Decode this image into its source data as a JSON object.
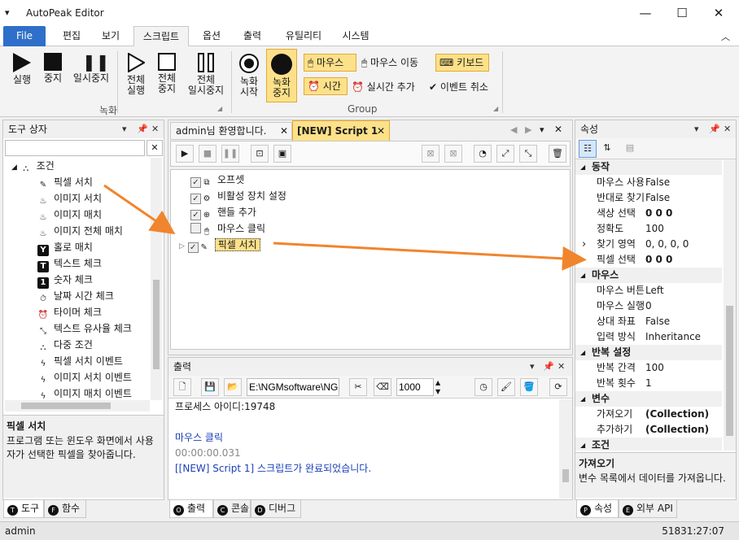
{
  "app": {
    "title": "AutoPeak Editor"
  },
  "menu_tabs": [
    "File",
    "편집",
    "보기",
    "스크립트",
    "옵션",
    "출력",
    "유틸리티",
    "시스템"
  ],
  "ribbon": {
    "record_group": "녹화",
    "group2": "Group",
    "buttons": {
      "run": "실행",
      "stop": "중지",
      "pause": "일시중지",
      "run_all_1": "전체",
      "run_all_2": "실행",
      "stop_all_1": "전체",
      "stop_all_2": "중지",
      "pause_all_1": "전체",
      "pause_all_2": "일시중지",
      "rec_start_1": "녹화",
      "rec_start_2": "시작",
      "rec_stop_1": "녹화",
      "rec_stop_2": "중지"
    },
    "opts": {
      "mouse": "마우스",
      "mouse_move": "마우스 이동",
      "keyboard": "키보드",
      "time": "시간",
      "realtime_add": "실시간 추가",
      "event_cancel": "이벤트 취소"
    }
  },
  "toolbox": {
    "title": "도구 상자",
    "root": "조건",
    "items": [
      "픽셀 서치",
      "이미지 서치",
      "이미지 매치",
      "이미지 전체 매치",
      "홀로 매치",
      "텍스트 체크",
      "숫자 체크",
      "날짜 시간 체크",
      "타이머 체크",
      "텍스트 유사율 체크",
      "다중 조건",
      "픽셀 서치 이벤트",
      "이미지 서치 이벤트",
      "이미지 매치 이벤트"
    ],
    "desc_title": "픽셀 서치",
    "desc_text": "프로그램 또는 윈도우 화면에서 사용자가 선택한 픽셀을 찾아줍니다.",
    "tabs": [
      "도구",
      "함수"
    ]
  },
  "doc_tabs": [
    "admin님 환영합니다.",
    "[NEW] Script 1"
  ],
  "script_items": [
    "오프셋",
    "비활성 장치 설정",
    "핸들 추가",
    "마우스 클릭",
    "픽셀 서치"
  ],
  "output": {
    "title": "출력",
    "path": "E:\\NGMsoftware\\NG",
    "count": "1000",
    "lines": [
      "프로세스 아이디:19748",
      "마우스 클릭",
      "00:00:00.031",
      "[[NEW] Script 1] 스크립트가 완료되었습니다."
    ],
    "tabs": [
      "출력",
      "콘솔",
      "디버그"
    ]
  },
  "properties": {
    "title": "속성",
    "rows": [
      {
        "cat": true,
        "k": "동작"
      },
      {
        "k": "마우스 사용",
        "v": "False"
      },
      {
        "k": "반대로 찾기",
        "v": "False"
      },
      {
        "k": "색상 선택",
        "v": "0 0 0"
      },
      {
        "k": "정확도",
        "v": "100"
      },
      {
        "k": "찾기 영역",
        "v": "0, 0, 0, 0"
      },
      {
        "k": "픽셀 선택",
        "v": "0 0 0"
      },
      {
        "cat": true,
        "k": "마우스"
      },
      {
        "k": "마우스 버튼",
        "v": "Left"
      },
      {
        "k": "마우스 실행",
        "v": "0"
      },
      {
        "k": "상대 좌표",
        "v": "False"
      },
      {
        "k": "입력 방식",
        "v": "Inheritance"
      },
      {
        "cat": true,
        "k": "반복 설정"
      },
      {
        "k": "반복 간격",
        "v": "100"
      },
      {
        "k": "반복 횟수",
        "v": "1"
      },
      {
        "cat": true,
        "k": "변수"
      },
      {
        "k": "가져오기",
        "v": "(Collection)"
      },
      {
        "k": "추가하기",
        "v": "(Collection)"
      },
      {
        "cat": true,
        "k": "조건"
      }
    ],
    "desc_title": "가져오기",
    "desc_text": "변수 목록에서 데이터를 가져옵니다.",
    "tabs": [
      "속성",
      "외부 API"
    ]
  },
  "status": {
    "user": "admin",
    "time": "51831:27:07"
  },
  "colors": {
    "accent": "#2e6fc9",
    "highlight": "#fde189",
    "arrow": "#f0852d"
  }
}
